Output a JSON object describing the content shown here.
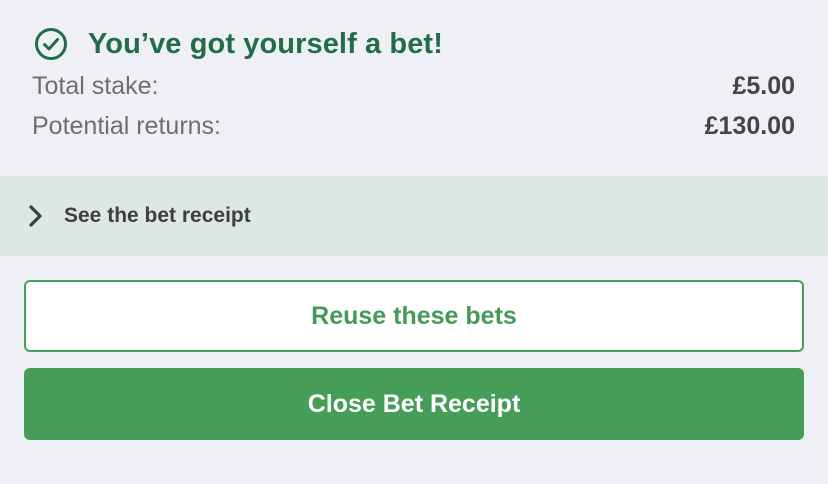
{
  "colors": {
    "brand_green": "#459d57",
    "title_green": "#236c4b",
    "toggle_bg": "#dce8e1",
    "page_bg": "#eff0f5"
  },
  "header": {
    "icon": "check-circle-icon",
    "title": "You’ve got yourself a bet!"
  },
  "summary": {
    "total_stake_label": "Total stake:",
    "total_stake_value": "£5.00",
    "potential_returns_label": "Potential returns:",
    "potential_returns_value": "£130.00"
  },
  "receipt_toggle": {
    "icon": "chevron-right-icon",
    "label": "See the bet receipt"
  },
  "actions": {
    "reuse_label": "Reuse these bets",
    "close_label": "Close Bet Receipt"
  }
}
